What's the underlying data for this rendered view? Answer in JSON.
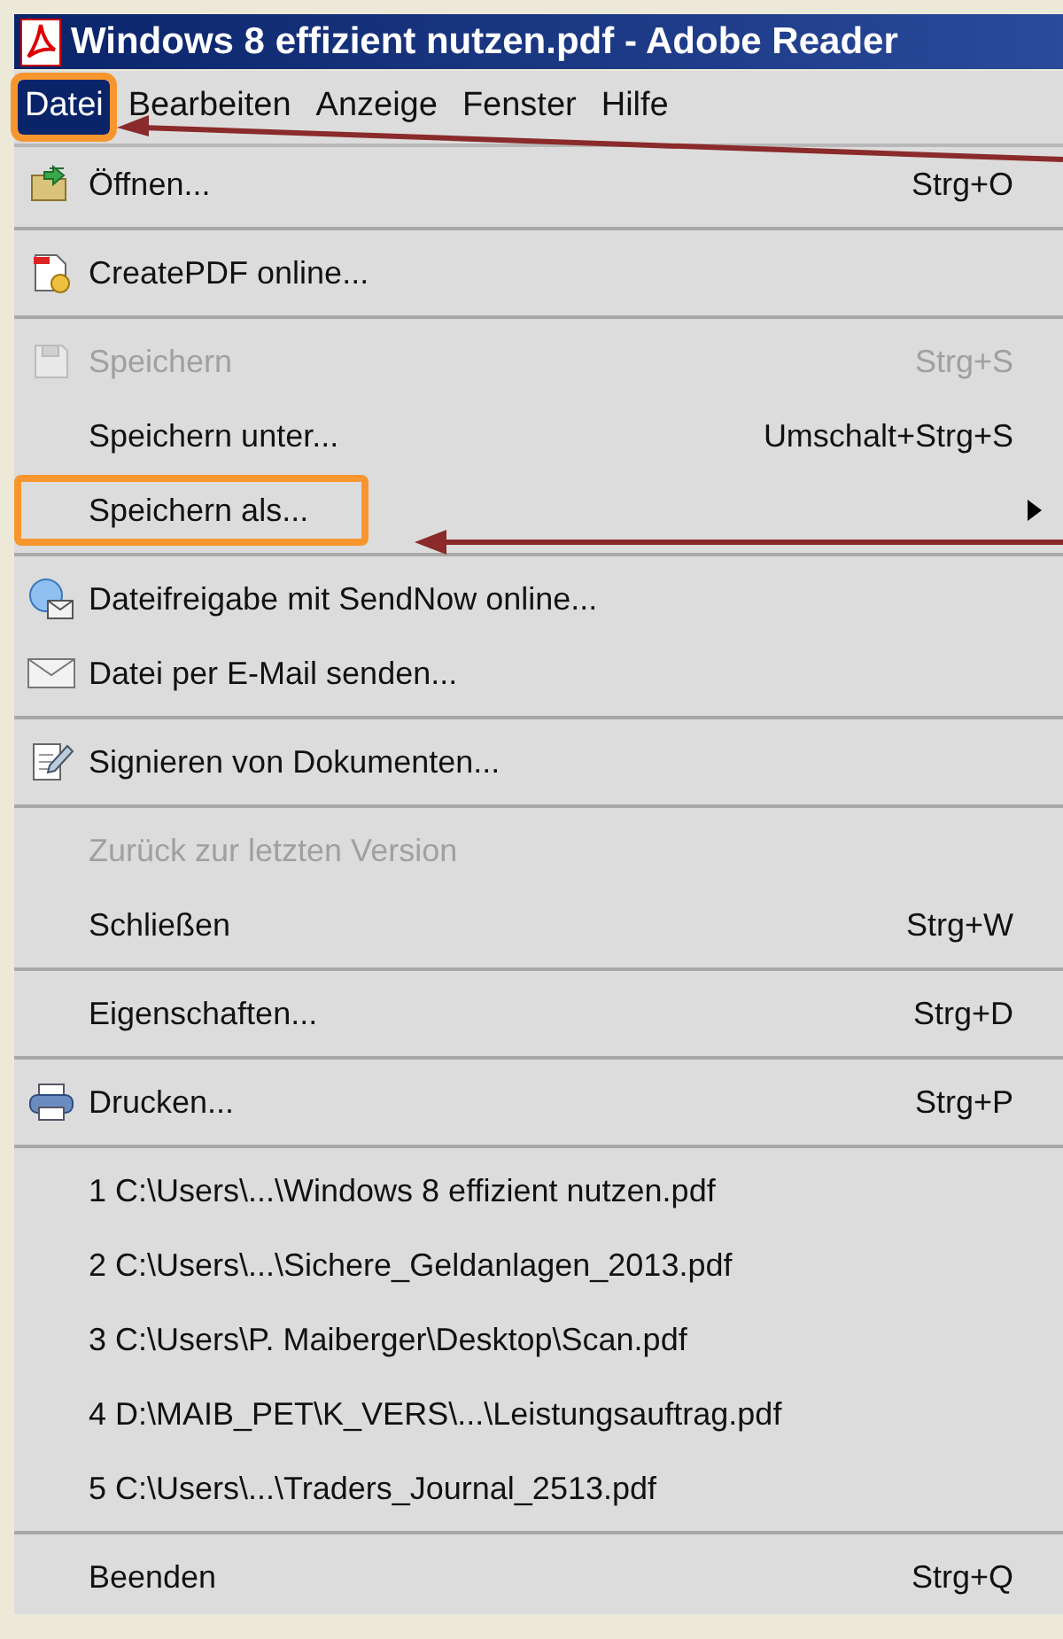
{
  "window": {
    "title": "Windows 8 effizient nutzen.pdf - Adobe Reader"
  },
  "menu_bar": [
    {
      "label": "Datei",
      "selected": true,
      "annotated": true
    },
    {
      "label": "Bearbeiten",
      "selected": false,
      "annotated": false
    },
    {
      "label": "Anzeige",
      "selected": false,
      "annotated": false
    },
    {
      "label": "Fenster",
      "selected": false,
      "annotated": false
    },
    {
      "label": "Hilfe",
      "selected": false,
      "annotated": false
    }
  ],
  "menu": [
    {
      "kind": "item",
      "label": "Öffnen...",
      "shortcut": "Strg+O",
      "disabled": false,
      "submenu": false,
      "annotated": false
    },
    {
      "kind": "separator"
    },
    {
      "kind": "item",
      "label": "CreatePDF online...",
      "disabled": false,
      "submenu": false,
      "annotated": false
    },
    {
      "kind": "separator"
    },
    {
      "kind": "item",
      "label": "Speichern",
      "shortcut": "Strg+S",
      "disabled": true,
      "submenu": false,
      "annotated": false
    },
    {
      "kind": "item",
      "label": "Speichern unter...",
      "shortcut": "Umschalt+Strg+S",
      "disabled": false,
      "submenu": false,
      "annotated": false
    },
    {
      "kind": "item",
      "label": "Speichern als...",
      "disabled": false,
      "submenu": true,
      "annotated": true
    },
    {
      "kind": "separator"
    },
    {
      "kind": "item",
      "label": "Dateifreigabe mit SendNow online...",
      "disabled": false,
      "submenu": false,
      "annotated": false
    },
    {
      "kind": "item",
      "label": "Datei per E-Mail senden...",
      "disabled": false,
      "submenu": false,
      "annotated": false
    },
    {
      "kind": "separator"
    },
    {
      "kind": "item",
      "label": "Signieren von Dokumenten...",
      "disabled": false,
      "submenu": false,
      "annotated": false
    },
    {
      "kind": "separator"
    },
    {
      "kind": "item",
      "label": "Zurück zur letzten Version",
      "disabled": true,
      "submenu": false,
      "annotated": false
    },
    {
      "kind": "item",
      "label": "Schließen",
      "shortcut": "Strg+W",
      "disabled": false,
      "submenu": false,
      "annotated": false
    },
    {
      "kind": "separator"
    },
    {
      "kind": "item",
      "label": "Eigenschaften...",
      "shortcut": "Strg+D",
      "disabled": false,
      "submenu": false,
      "annotated": false
    },
    {
      "kind": "separator"
    },
    {
      "kind": "item",
      "label": "Drucken...",
      "shortcut": "Strg+P",
      "disabled": false,
      "submenu": false,
      "annotated": false
    },
    {
      "kind": "separator"
    },
    {
      "kind": "item",
      "label": "1 C:\\Users\\...\\Windows 8 effizient nutzen.pdf",
      "disabled": false,
      "submenu": false,
      "annotated": false
    },
    {
      "kind": "item",
      "label": "2 C:\\Users\\...\\Sichere_Geldanlagen_2013.pdf",
      "disabled": false,
      "submenu": false,
      "annotated": false
    },
    {
      "kind": "item",
      "label": "3 C:\\Users\\P. Maiberger\\Desktop\\Scan.pdf",
      "disabled": false,
      "submenu": false,
      "annotated": false
    },
    {
      "kind": "item",
      "label": "4 D:\\MAIB_PET\\K_VERS\\...\\Leistungsauftrag.pdf",
      "disabled": false,
      "submenu": false,
      "annotated": false
    },
    {
      "kind": "item",
      "label": "5 C:\\Users\\...\\Traders_Journal_2513.pdf",
      "disabled": false,
      "submenu": false,
      "annotated": false
    },
    {
      "kind": "separator"
    },
    {
      "kind": "item",
      "label": "Beenden",
      "shortcut": "Strg+Q",
      "disabled": false,
      "submenu": false,
      "annotated": false
    }
  ]
}
